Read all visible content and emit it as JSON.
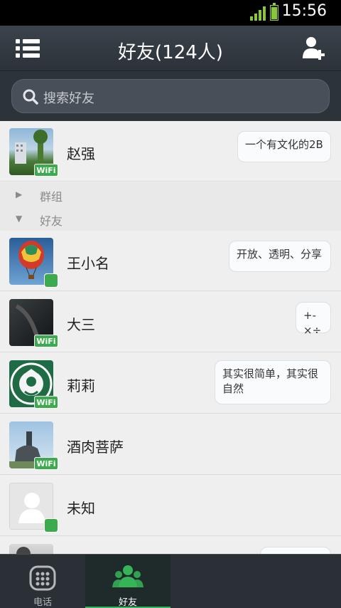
{
  "status_bar": {
    "time": "15:56"
  },
  "header": {
    "title": "好友(124人)",
    "menu_icon": "list-icon",
    "add_icon": "add-friend-icon"
  },
  "search": {
    "placeholder": "搜索好友"
  },
  "top_contact": {
    "name": "赵强",
    "badge": "WiFi",
    "status": "一个有文化的2B"
  },
  "groups": [
    {
      "label": "群组",
      "expanded": false
    },
    {
      "label": "好友",
      "expanded": true
    }
  ],
  "friends": [
    {
      "name": "王小名",
      "badge_type": "dot",
      "status": "开放、透明、分享"
    },
    {
      "name": "大三",
      "badge_type": "wifi",
      "badge": "WiFi",
      "status": "+-×÷"
    },
    {
      "name": "莉莉",
      "badge_type": "wifi",
      "badge": "WiFi",
      "status_line1": "其实很简单，其实很",
      "status_line2": "自然"
    },
    {
      "name": "酒肉菩萨",
      "badge_type": "wifi",
      "badge": "WiFi"
    },
    {
      "name": "未知",
      "badge_type": "dot"
    }
  ],
  "tabs": [
    {
      "label": "电话",
      "icon": "dialpad-icon",
      "active": false
    },
    {
      "label": "好友",
      "icon": "contacts-icon",
      "active": true
    }
  ],
  "colors": {
    "accent": "#35b558",
    "header_bg": "#2d3439",
    "badge": "#3bab4e"
  }
}
